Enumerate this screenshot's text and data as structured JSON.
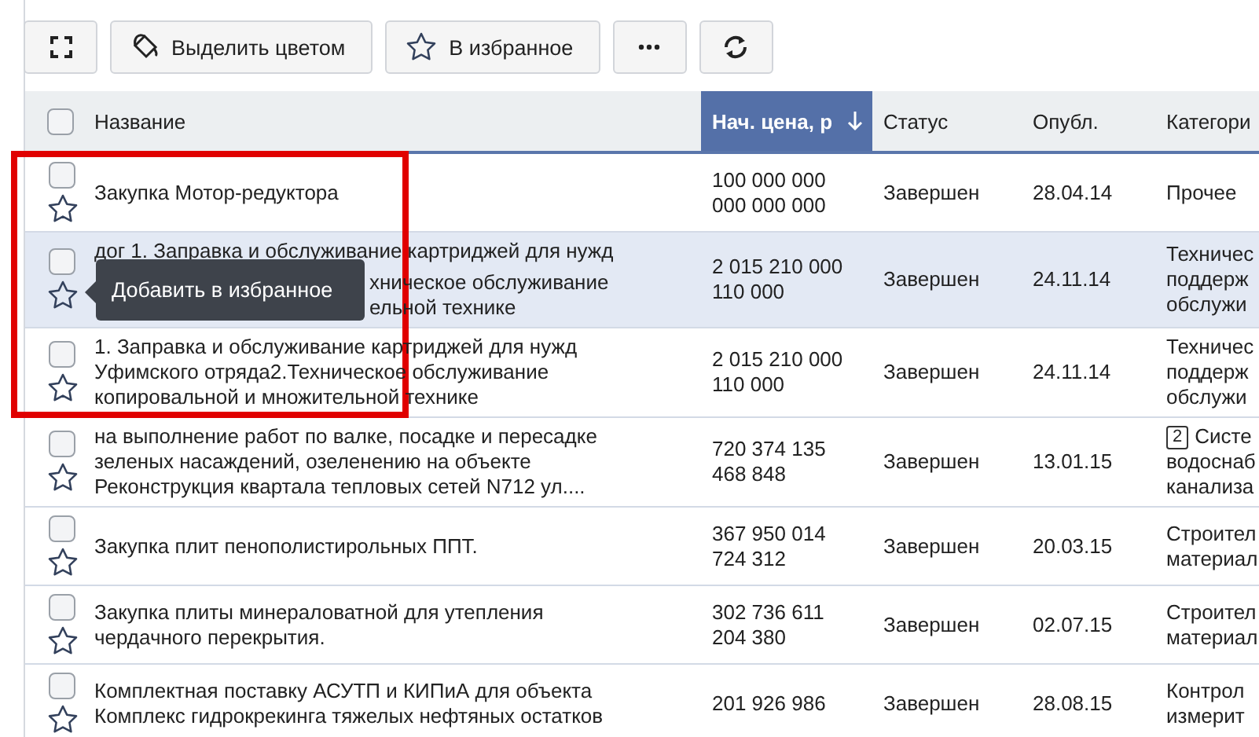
{
  "toolbar": [
    {
      "kind": "expand"
    },
    {
      "kind": "color",
      "label": "Выделить цветом"
    },
    {
      "kind": "favorite",
      "label": "В избранное"
    },
    {
      "kind": "more"
    },
    {
      "kind": "refresh"
    }
  ],
  "table": {
    "columns": [
      {
        "label": "Название",
        "sorted": false
      },
      {
        "label": "Нач. цена, р",
        "sorted": true
      },
      {
        "label": "Статус",
        "sorted": false
      },
      {
        "label": "Опубл.",
        "sorted": false
      },
      {
        "label": "Категори",
        "sorted": false
      }
    ],
    "all_checked": false,
    "rows": [
      {
        "checked": false,
        "favorite": false,
        "highlighted": false,
        "name": "Закупка Мотор-редуктора",
        "price": "100 000 000\n000 000 000",
        "status": "Завершен",
        "date": "28.04.14",
        "category": "Прочее"
      },
      {
        "checked": false,
        "favorite": false,
        "highlighted": true,
        "name": "дог 1. Заправка и обслуживание картриджей для нужд",
        "name_uncovered": [
          "хническое обслуживание",
          "ельной технике"
        ],
        "price": "2 015 210 000\n110 000",
        "status": "Завершен",
        "date": "24.11.14",
        "category": "Техничес\nподдерж\nобслужи",
        "tooltip": "Добавить в избранное"
      },
      {
        "checked": false,
        "favorite": false,
        "highlighted": false,
        "name": "1. Заправка и обслуживание картриджей для нужд\nУфимского отряда2.Техническое обслуживание\nкопировальной и множительной технике",
        "price": "2 015 210 000\n110 000",
        "status": "Завершен",
        "date": "24.11.14",
        "category": "Техничес\nподдерж\nобслужи"
      },
      {
        "checked": false,
        "favorite": false,
        "highlighted": false,
        "name": "на выполнение работ по валке, посадке и пересадке\nзеленых насаждений, озеленению на объекте\nРеконструкция квартала тепловых сетей N712 ул....",
        "price": "720 374 135\n468 848",
        "status": "Завершен",
        "date": "13.01.15",
        "badge": "2",
        "category": "Систе\nводоснаб\nканализа"
      },
      {
        "checked": false,
        "favorite": false,
        "highlighted": false,
        "name": "Закупка плит пенополистирольных ППТ.",
        "price": "367 950 014\n724 312",
        "status": "Завершен",
        "date": "20.03.15",
        "category": "Строител\nматериал"
      },
      {
        "checked": false,
        "favorite": false,
        "highlighted": false,
        "name": "Закупка плиты минераловатной для утепления\nчердачного перекрытия.",
        "price": "302 736 611\n204 380",
        "status": "Завершен",
        "date": "02.07.15",
        "category": "Строител\nматериал"
      },
      {
        "checked": false,
        "favorite": false,
        "highlighted": false,
        "name": "Комплектная поставку АСУТП и КИПиА для объекта\nКомплекс гидрокрекинга тяжелых нефтяных остатков",
        "price": "201 926 986",
        "status": "Завершен",
        "date": "28.08.15",
        "category": "Контрол\nизмерит"
      }
    ]
  }
}
